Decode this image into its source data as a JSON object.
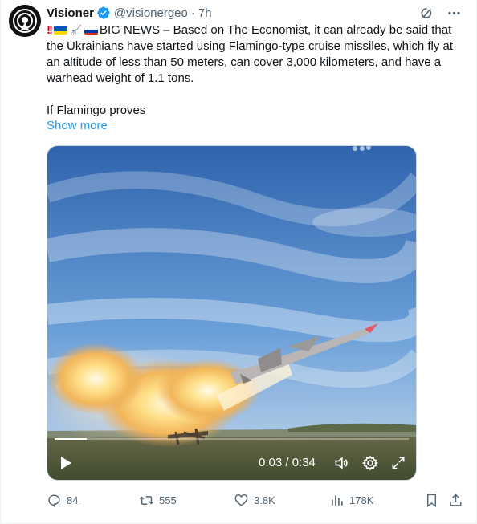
{
  "author": {
    "name": "Visioner",
    "handle": "@visionergeo",
    "separator": "·",
    "time": "7h"
  },
  "post": {
    "prefix_emojis": [
      "double-exclamation",
      "ukraine-flag",
      "rocket",
      "russia-flag"
    ],
    "line1": "BIG NEWS – Based on The Economist, it can already be said that the Ukrainians have started using Flamingo-type cruise missiles, which fly at an altitude of less than 50 meters, can cover 3,000 kilometers, and have a warhead weight of 1.1 tons.",
    "line2": "If Flamingo proves",
    "show_more": "Show more"
  },
  "video": {
    "timecode": "0:03 / 0:34",
    "progress_fraction": 0.09
  },
  "actions": {
    "replies": "84",
    "reposts": "555",
    "likes": "3.8K",
    "views": "178K"
  },
  "colors": {
    "accent": "#1d9bf0",
    "muted": "#536471",
    "verified": "#1d9bf0"
  }
}
